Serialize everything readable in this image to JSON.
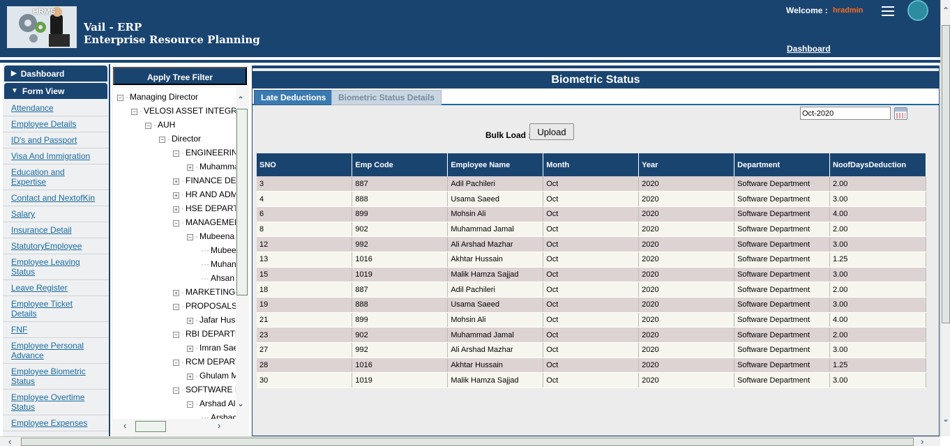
{
  "header": {
    "logo_text": "HRMS",
    "app_name": "Vail - ERP",
    "app_subtitle": "Enterprise Resource Planning",
    "welcome_label": "Welcome :",
    "username": "hradmin",
    "dashboard_link": "Dashboard"
  },
  "menu": {
    "dashboard_label": "Dashboard",
    "form_view_label": "Form View",
    "items": [
      "Attendance",
      "Employee Details",
      "ID's and Passport",
      "Visa And Immigration",
      "Education and Expertise",
      "Contact and NextofKin",
      "Salary",
      "Insurance Detail",
      "StatutoryEmployee",
      "Employee Leaving Status",
      "Leave Register",
      "Employee Ticket Details",
      "FNF",
      "Employee Personal Advance",
      "Employee Biometric Status",
      "Employee Overtime Status",
      "Employee Expenses"
    ]
  },
  "tree": {
    "filter_button": "Apply Tree Filter",
    "nodes": [
      {
        "label": "Managing Director",
        "expanded": true
      },
      {
        "label": "VELOSI ASSET INTEGRIT",
        "expanded": true
      },
      {
        "label": "AUH",
        "expanded": true
      },
      {
        "label": "Director",
        "expanded": true
      },
      {
        "label": "ENGINEERING",
        "expanded": true
      },
      {
        "label": "Muhamma",
        "expanded": false
      },
      {
        "label": "FINANCE DEPA",
        "expanded": false
      },
      {
        "label": "HR AND ADMI",
        "expanded": false
      },
      {
        "label": "HSE DEPARTM",
        "expanded": false
      },
      {
        "label": "MANAGEMENT",
        "expanded": true
      },
      {
        "label": "Mubeena",
        "expanded": true
      },
      {
        "label": "Mubee",
        "expanded": null
      },
      {
        "label": "Muhan",
        "expanded": null
      },
      {
        "label": "Ahsan",
        "expanded": null
      },
      {
        "label": "MARKETING D",
        "expanded": false
      },
      {
        "label": "PROPOSALS A",
        "expanded": true
      },
      {
        "label": "Jafar Huss",
        "expanded": false
      },
      {
        "label": "RBI DEPARTM",
        "expanded": true
      },
      {
        "label": "Imran Sae",
        "expanded": false
      },
      {
        "label": "RCM DEPARTM",
        "expanded": true
      },
      {
        "label": "Ghulam M",
        "expanded": false
      },
      {
        "label": "SOFTWARE D",
        "expanded": true
      },
      {
        "label": "Arshad Ali",
        "expanded": true
      },
      {
        "label": "Arshac",
        "expanded": null
      }
    ]
  },
  "main": {
    "title": "Biometric Status",
    "tabs": [
      "Late Deductions",
      "Biometric Status Details"
    ],
    "month_value": "Oct-2020",
    "bulk_load_label": "Bulk Load :",
    "upload_label": "Upload",
    "columns": [
      "SNO",
      "Emp Code",
      "Employee Name",
      "Month",
      "Year",
      "Department",
      "NoofDaysDeduction"
    ],
    "rows": [
      [
        "3",
        "887",
        "Adil Pachileri",
        "Oct",
        "2020",
        "Software Department",
        "2.00"
      ],
      [
        "4",
        "888",
        "Usama Saeed",
        "Oct",
        "2020",
        "Software Department",
        "3.00"
      ],
      [
        "6",
        "899",
        "Mohsin Ali",
        "Oct",
        "2020",
        "Software Department",
        "4.00"
      ],
      [
        "8",
        "902",
        "Muhammad Jamal",
        "Oct",
        "2020",
        "Software Department",
        "2.00"
      ],
      [
        "12",
        "992",
        "Ali Arshad Mazhar",
        "Oct",
        "2020",
        "Software Department",
        "3.00"
      ],
      [
        "13",
        "1016",
        "Akhtar Hussain",
        "Oct",
        "2020",
        "Software Department",
        "1.25"
      ],
      [
        "15",
        "1019",
        "Malik Hamza Sajjad",
        "Oct",
        "2020",
        "Software Department",
        "3.00"
      ],
      [
        "18",
        "887",
        "Adil Pachileri",
        "Oct",
        "2020",
        "Software Department",
        "2.00"
      ],
      [
        "19",
        "888",
        "Usama Saeed",
        "Oct",
        "2020",
        "Software Department",
        "3.00"
      ],
      [
        "21",
        "899",
        "Mohsin Ali",
        "Oct",
        "2020",
        "Software Department",
        "4.00"
      ],
      [
        "23",
        "902",
        "Muhammad Jamal",
        "Oct",
        "2020",
        "Software Department",
        "2.00"
      ],
      [
        "27",
        "992",
        "Ali Arshad Mazhar",
        "Oct",
        "2020",
        "Software Department",
        "3.00"
      ],
      [
        "28",
        "1016",
        "Akhtar Hussain",
        "Oct",
        "2020",
        "Software Department",
        "1.25"
      ],
      [
        "30",
        "1019",
        "Malik Hamza Sajjad",
        "Oct",
        "2020",
        "Software Department",
        "3.00"
      ]
    ]
  },
  "colors": {
    "primary": "#1a4470",
    "username": "#ff6a1a",
    "link": "#1a6aa0",
    "row_odd": "#ddd3d3",
    "row_even": "#f6f6ee"
  }
}
